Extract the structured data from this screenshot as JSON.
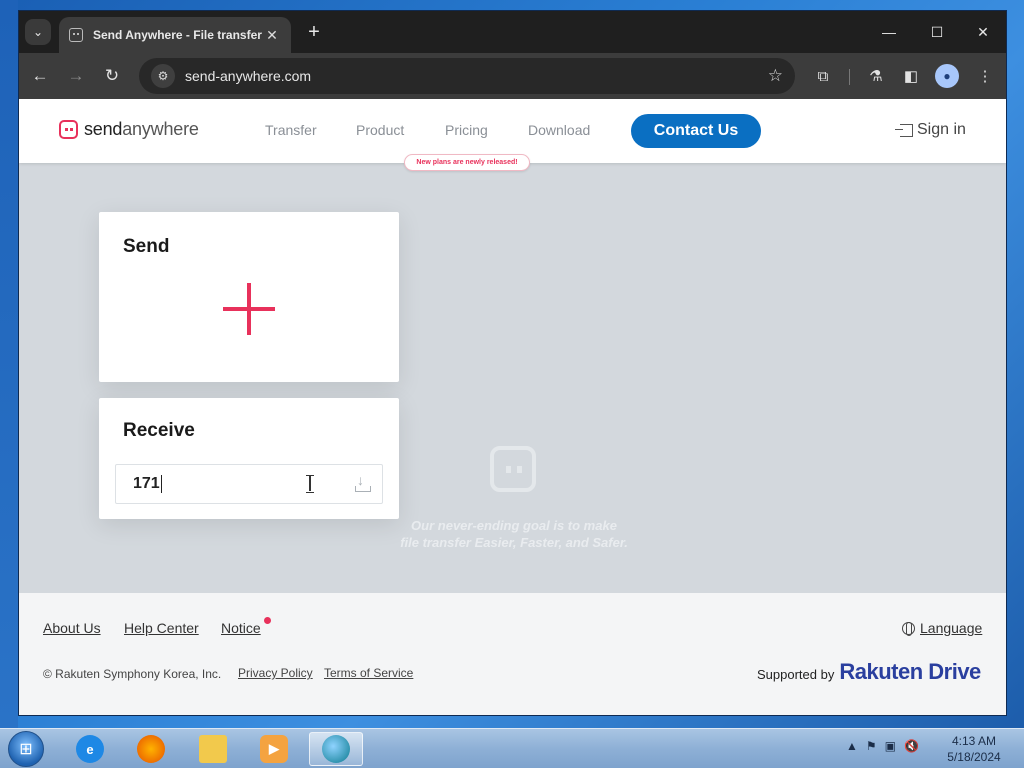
{
  "browser": {
    "tab_title": "Send Anywhere - File transfer",
    "url": "send-anywhere.com"
  },
  "site": {
    "logo_send": "send",
    "logo_anywhere": "anywhere",
    "nav": [
      "Transfer",
      "Product",
      "Pricing",
      "Download"
    ],
    "pricing_note": "New plans are newly released!",
    "contact_label": "Contact Us",
    "signin_label": "Sign in"
  },
  "send_card": {
    "title": "Send"
  },
  "receive_card": {
    "title": "Receive",
    "key_value": "171"
  },
  "tagline": {
    "line1": "Our never-ending goal is to make",
    "line2": "file transfer Easier, Faster, and Safer."
  },
  "footer": {
    "about": "About Us",
    "help": "Help Center",
    "notice": "Notice",
    "language": "Language",
    "copyright": "© Rakuten Symphony Korea, Inc.",
    "privacy": "Privacy Policy",
    "terms": "Terms of Service",
    "supported_by": "Supported by",
    "rakuten_drive": "Rakuten Drive"
  },
  "taskbar": {
    "time": "4:13 AM",
    "date": "5/18/2024"
  },
  "colors": {
    "brand_pink": "#e8315b",
    "contact_blue": "#0a6fc2",
    "page_bg": "#d3d8dd"
  }
}
